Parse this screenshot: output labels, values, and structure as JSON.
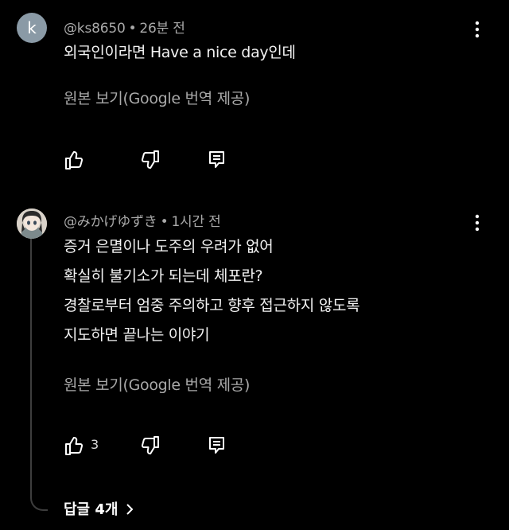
{
  "comments": [
    {
      "avatar_letter": "k",
      "handle": "@ks8650",
      "separator": "•",
      "time": "26분 전",
      "lines": [
        "외국인이라면 Have a nice day인데"
      ],
      "translate_label": "원본 보기(Google 번역 제공)",
      "like_count": ""
    },
    {
      "handle": "@みかげゆずき",
      "separator": "•",
      "time": "1시간 전",
      "lines": [
        "증거 은멸이나 도주의 우려가 없어",
        "확실히 불기소가 되는데 체포란?",
        "경찰로부터 엄중 주의하고 향후 접근하지 않도록",
        "지도하면 끝나는 이야기"
      ],
      "translate_label": "원본 보기(Google 번역 제공)",
      "like_count": "3"
    }
  ],
  "replies": {
    "label": "답글 4개"
  },
  "icons": {
    "like": "thumbs-up-icon",
    "dislike": "thumbs-down-icon",
    "reply": "reply-icon",
    "more": "more-vertical-icon",
    "expand": "chevron-right-icon"
  },
  "colors": {
    "background": "#000000",
    "text_primary": "#f2f2f2",
    "text_secondary": "#a9a9a9",
    "avatar_bg": "#8a9aa6"
  }
}
